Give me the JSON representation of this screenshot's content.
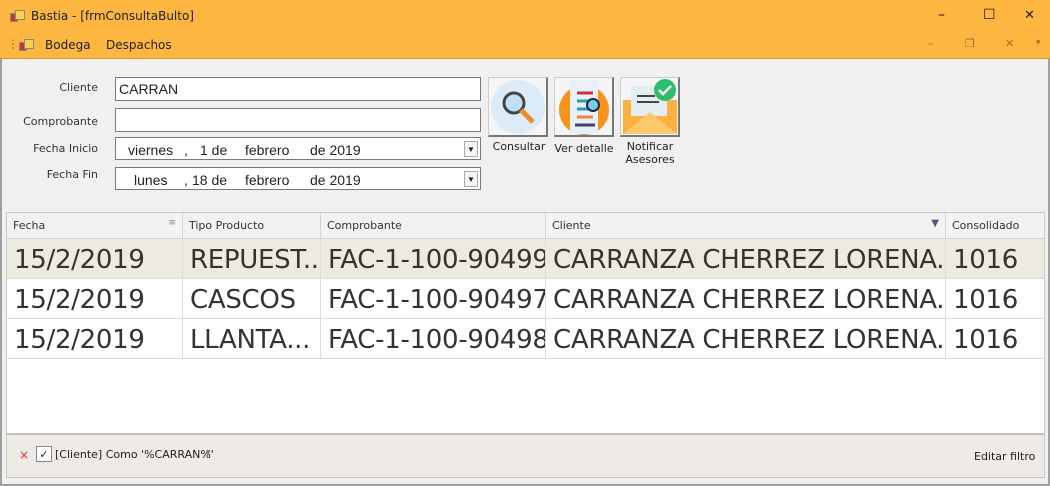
{
  "window": {
    "title": "Bastia - [frmConsultaBulto]",
    "minimize": "–",
    "maximize": "☐",
    "close": "✕"
  },
  "menu": {
    "items": [
      "Bodega",
      "Despachos"
    ],
    "mdi_minimize": "–",
    "mdi_restore": "❐",
    "mdi_close": "✕",
    "overflow": "▾"
  },
  "form": {
    "cliente_label": "Cliente",
    "cliente_value": "CARRAN",
    "comprobante_label": "Comprobante",
    "comprobante_value": "",
    "fecha_inicio_label": "Fecha Inicio",
    "fecha_inicio": {
      "weekday": "viernes",
      "comma": ",",
      "day": "1 de",
      "month": "febrero",
      "year": "de 2019"
    },
    "fecha_fin_label": "Fecha Fin",
    "fecha_fin": {
      "weekday": "lunes",
      "comma": ",",
      "day": "18 de",
      "month": "febrero",
      "year": "de 2019"
    }
  },
  "toolbar": {
    "consultar": "Consultar",
    "ver_detalle": "Ver detalle",
    "notificar_1": "Notificar",
    "notificar_2": "Asesores"
  },
  "grid": {
    "columns": [
      "Fecha",
      "Tipo Producto",
      "Comprobante",
      "Cliente",
      "Consolidado"
    ],
    "rows": [
      [
        "15/2/2019",
        "REPUEST...",
        "FAC-1-100-90499",
        "CARRANZA CHERREZ LORENA...",
        "1016"
      ],
      [
        "15/2/2019",
        "CASCOS",
        "FAC-1-100-90497",
        "CARRANZA CHERREZ LORENA...",
        "1016"
      ],
      [
        "15/2/2019",
        "LLANTA...",
        "FAC-1-100-90498",
        "CARRANZA CHERREZ LORENA...",
        "1016"
      ]
    ],
    "selected_row": 0
  },
  "filter": {
    "clear": "×",
    "check": "✓",
    "text": "[Cliente] Como '%CARRAN%'",
    "dropdown": "▾",
    "edit": "Editar filtro"
  },
  "colors": {
    "accent": "#FDB63F",
    "selected_row": "#EDEAE0"
  }
}
